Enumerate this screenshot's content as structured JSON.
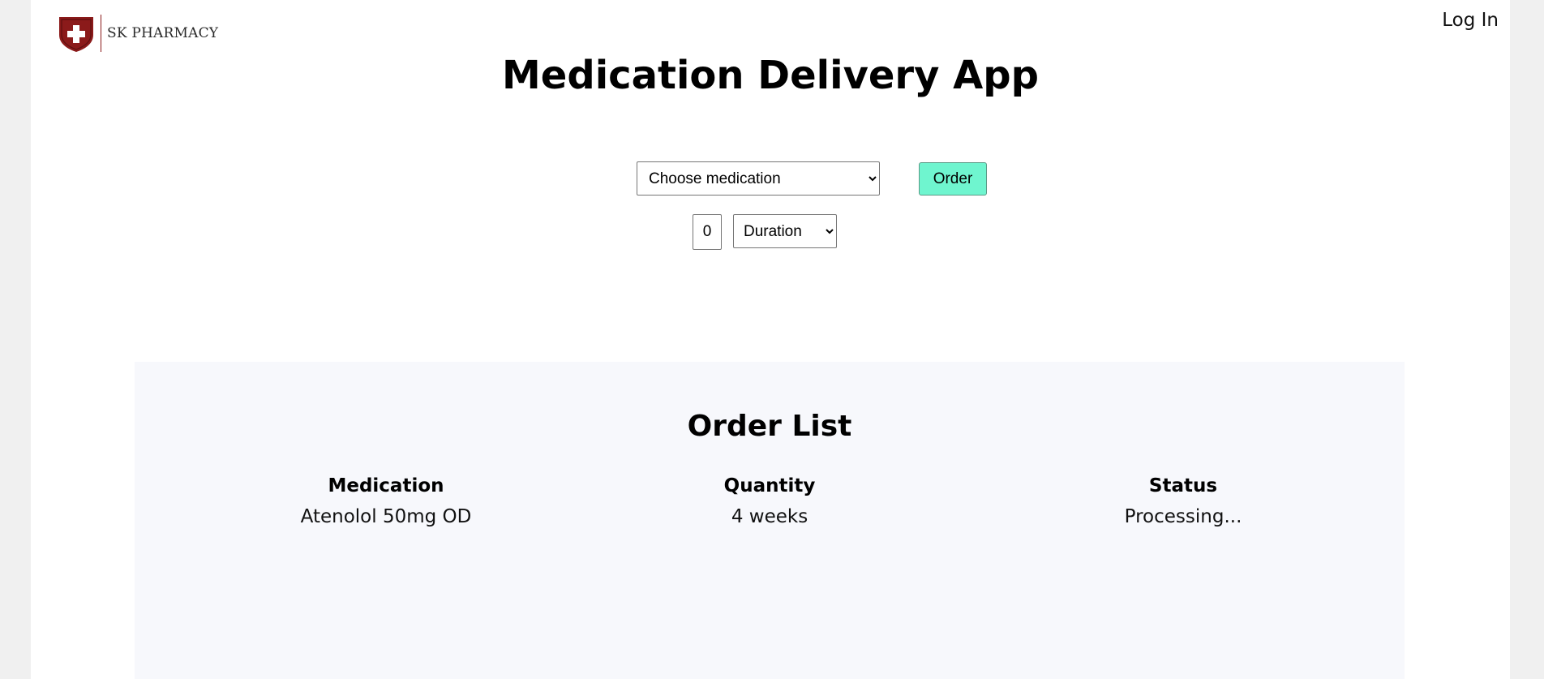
{
  "header": {
    "brand": "SK PHARMACY",
    "login_label": "Log In"
  },
  "main": {
    "title": "Medication Delivery App",
    "medication_select": {
      "selected": "Choose medication",
      "options": [
        "Choose medication"
      ]
    },
    "order_button_label": "Order",
    "quantity_value": "0",
    "duration_select": {
      "selected": "Duration",
      "options": [
        "Duration"
      ]
    }
  },
  "order_list": {
    "title": "Order List",
    "columns": [
      "Medication",
      "Quantity",
      "Status"
    ],
    "rows": [
      {
        "medication": "Atenolol 50mg OD",
        "quantity": "4 weeks",
        "status": "Processing..."
      }
    ]
  },
  "colors": {
    "order_button": "#6ff5cf",
    "brand": "#8b1a1a",
    "panel_bg": "#f7f8fc"
  }
}
